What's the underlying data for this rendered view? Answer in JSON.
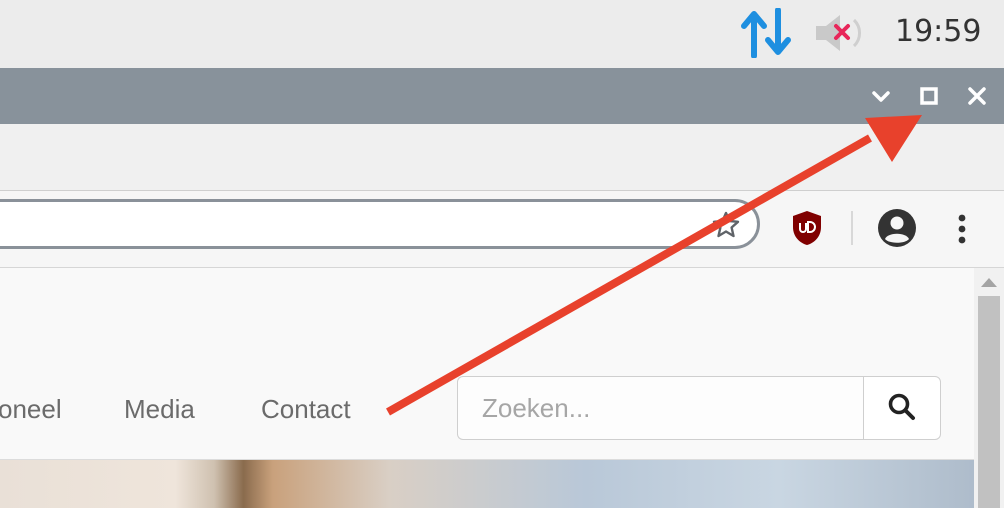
{
  "taskbar": {
    "clock": "19:59",
    "network_icon": "network-transfer-icon",
    "volume_icon": "volume-muted-icon",
    "colors": {
      "network": "#1e8fe0",
      "mute_x": "#e8265a"
    }
  },
  "window": {
    "buttons": [
      "minimize",
      "maximize",
      "close"
    ],
    "titlebar_color": "#88929b"
  },
  "toolbar": {
    "address_value": "",
    "bookmark_icon": "star-icon",
    "extension_icon": "ublock-origin-icon",
    "profile_icon": "account-circle-icon",
    "menu_icon": "more-vert-icon"
  },
  "page": {
    "nav": {
      "items": [
        "oneel",
        "Media",
        "Contact"
      ]
    },
    "search": {
      "placeholder": "Zoeken...",
      "button_icon": "search-icon"
    }
  },
  "annotation": {
    "type": "arrow",
    "color": "#e8412c",
    "points_to": "maximize-button"
  }
}
